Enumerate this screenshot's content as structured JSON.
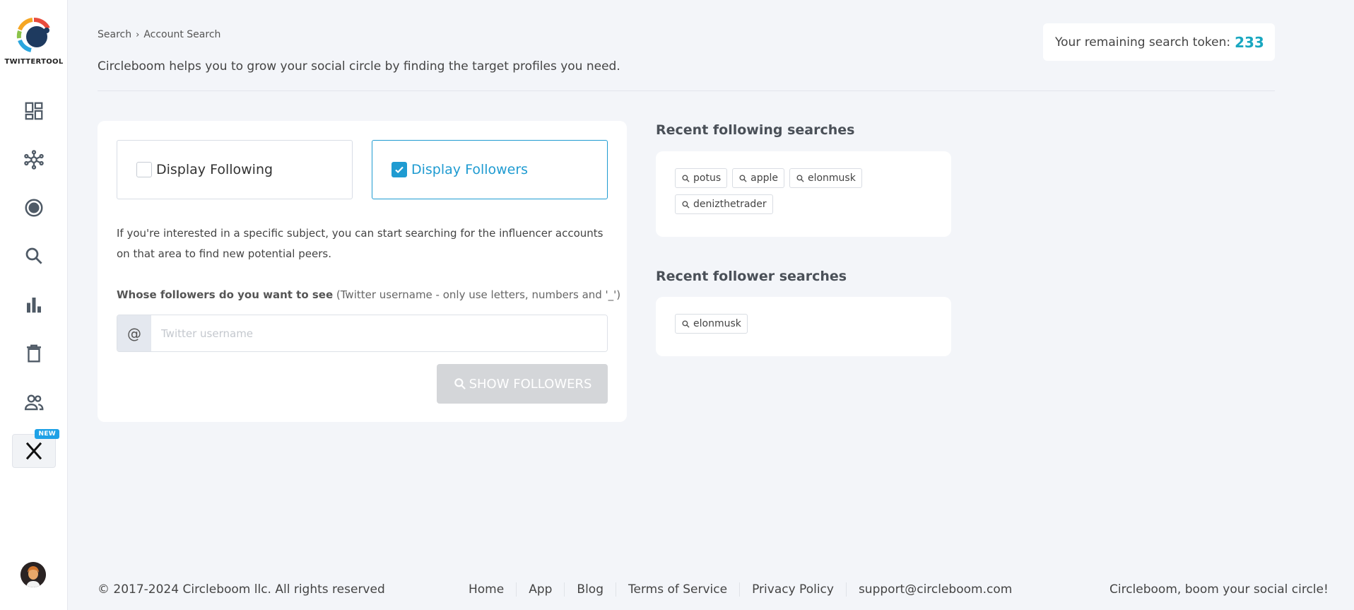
{
  "brand": {
    "name": "TWITTERTOOL"
  },
  "breadcrumb": {
    "parent": "Search",
    "current": "Account Search"
  },
  "header": {
    "tagline": "Circleboom helps you to grow your social circle by finding the target profiles you need."
  },
  "token": {
    "label": "Your remaining search token:",
    "value": "233"
  },
  "nav": {
    "items": [
      {
        "name": "dashboard"
      },
      {
        "name": "circle"
      },
      {
        "name": "target"
      },
      {
        "name": "search"
      },
      {
        "name": "analytics"
      },
      {
        "name": "delete"
      },
      {
        "name": "users"
      },
      {
        "name": "x",
        "badge": "NEW"
      }
    ]
  },
  "options": {
    "following": {
      "label": "Display Following",
      "checked": false
    },
    "followers": {
      "label": "Display Followers",
      "checked": true
    }
  },
  "info_text": "If you're interested in a specific subject, you can start searching for the influencer accounts on that area to find new potential peers.",
  "field": {
    "label_bold": "Whose followers do you want to see",
    "label_hint": " (Twitter username - only use letters, numbers and '_')",
    "prefix": "@",
    "placeholder": "Twitter username",
    "value": ""
  },
  "button": {
    "label": "SHOW FOLLOWERS"
  },
  "recent_following": {
    "title": "Recent following searches",
    "items": [
      "potus",
      "apple",
      "elonmusk",
      "denizthetrader"
    ]
  },
  "recent_followers": {
    "title": "Recent follower searches",
    "items": [
      "elonmusk"
    ]
  },
  "footer": {
    "copyright": "© 2017-2024 Circleboom llc. All rights reserved",
    "links": [
      "Home",
      "App",
      "Blog",
      "Terms of Service",
      "Privacy Policy",
      "support@circleboom.com"
    ],
    "slogan": "Circleboom, boom your social circle!"
  },
  "colors": {
    "accent": "#1f9bd1",
    "token": "#19a7c0",
    "background": "#f3f5f9",
    "icon": "#4f5a66"
  }
}
